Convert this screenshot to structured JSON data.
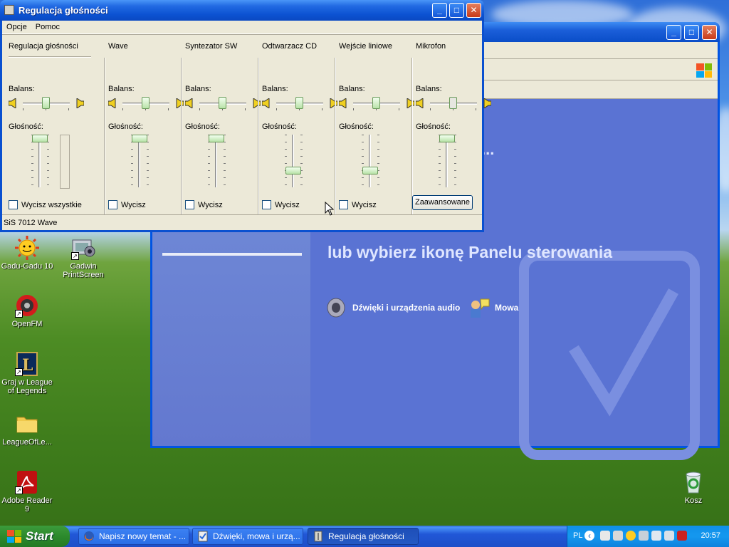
{
  "volume_window": {
    "title": "Regulacja głośności",
    "menu": [
      "Opcje",
      "Pomoc"
    ],
    "balance_label": "Balans:",
    "volume_label": "Głośność:",
    "columns": [
      {
        "name": "Regulacja głośności",
        "mute_label": "Wycisz wszystkie",
        "balance": 0.5,
        "volume": 1.0
      },
      {
        "name": "Wave",
        "mute_label": "Wycisz",
        "balance": 0.5,
        "volume": 1.0
      },
      {
        "name": "Syntezator SW",
        "mute_label": "Wycisz",
        "balance": 0.5,
        "volume": 1.0
      },
      {
        "name": "Odtwarzacz CD",
        "mute_label": "Wycisz",
        "balance": 0.5,
        "volume": 0.3
      },
      {
        "name": "Wejście liniowe",
        "mute_label": "Wycisz",
        "balance": 0.5,
        "volume": 0.3
      },
      {
        "name": "Mikrofon",
        "mute_label": "Wycisz",
        "balance": 0.5,
        "volume": 1.0
      }
    ],
    "advanced_button": "Zaawansowane",
    "status": "SiS 7012 Wave"
  },
  "control_panel": {
    "heading": "lub wybierz ikonę Panelu sterowania",
    "links": [
      "Dźwięki i urządzenia audio",
      "Mowa"
    ],
    "ellipsis": "..."
  },
  "desktop_icons": [
    {
      "label": "Gadu-Gadu 10",
      "icon": "sun-icon"
    },
    {
      "label": "Gadwin PrintScreen",
      "icon": "camera-icon"
    },
    {
      "label": "OpenFM",
      "icon": "radio-icon"
    },
    {
      "label": "Graj w League of Legends",
      "icon": "lol-icon"
    },
    {
      "label": "LeagueOfLe...",
      "icon": "folder-icon"
    },
    {
      "label": "Adobe Reader 9",
      "icon": "pdf-icon"
    },
    {
      "label": "Kosz",
      "icon": "recycle-bin-icon"
    }
  ],
  "taskbar": {
    "start": "Start",
    "buttons": [
      {
        "label": "Napisz nowy temat - ...",
        "icon": "firefox-icon"
      },
      {
        "label": "Dźwięki, mowa i urzą...",
        "icon": "control-panel-icon"
      },
      {
        "label": "Regulacja głośności",
        "icon": "volume-icon"
      }
    ],
    "lang": "PL",
    "clock": "20:57"
  }
}
